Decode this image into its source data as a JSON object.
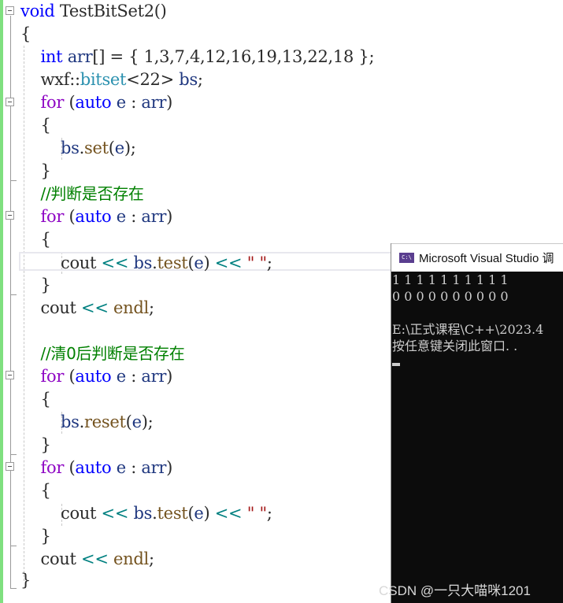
{
  "editor": {
    "lines": [
      {
        "segments": [
          {
            "t": "void",
            "c": "kw"
          },
          {
            "t": " TestBitSet2()",
            "c": "ns"
          }
        ]
      },
      {
        "segments": [
          {
            "t": "{",
            "c": "ns"
          }
        ]
      },
      {
        "segments": [
          {
            "t": "    "
          },
          {
            "t": "int",
            "c": "kw"
          },
          {
            "t": " "
          },
          {
            "t": "arr",
            "c": "var"
          },
          {
            "t": "[] = { 1,3,7,4,12,16,19,13,22,18 };",
            "c": "ns"
          }
        ]
      },
      {
        "segments": [
          {
            "t": "    wxf::",
            "c": "ns"
          },
          {
            "t": "bitset",
            "c": "type"
          },
          {
            "t": "<22> ",
            "c": "ns"
          },
          {
            "t": "bs",
            "c": "var"
          },
          {
            "t": ";",
            "c": "ns"
          }
        ]
      },
      {
        "segments": [
          {
            "t": "    "
          },
          {
            "t": "for",
            "c": "kw2"
          },
          {
            "t": " (",
            "c": "ns"
          },
          {
            "t": "auto",
            "c": "kw"
          },
          {
            "t": " "
          },
          {
            "t": "e",
            "c": "var"
          },
          {
            "t": " : ",
            "c": "ns"
          },
          {
            "t": "arr",
            "c": "var"
          },
          {
            "t": ")",
            "c": "ns"
          }
        ]
      },
      {
        "segments": [
          {
            "t": "    {",
            "c": "ns"
          }
        ]
      },
      {
        "segments": [
          {
            "t": "        "
          },
          {
            "t": "bs",
            "c": "var"
          },
          {
            "t": ".",
            "c": "ns"
          },
          {
            "t": "set",
            "c": "fn"
          },
          {
            "t": "(",
            "c": "ns"
          },
          {
            "t": "e",
            "c": "var"
          },
          {
            "t": ");",
            "c": "ns"
          }
        ]
      },
      {
        "segments": [
          {
            "t": "    }",
            "c": "ns"
          }
        ]
      },
      {
        "segments": [
          {
            "t": "    "
          },
          {
            "t": "//判断是否存在",
            "c": "cmt"
          }
        ]
      },
      {
        "segments": [
          {
            "t": "    "
          },
          {
            "t": "for",
            "c": "kw2"
          },
          {
            "t": " (",
            "c": "ns"
          },
          {
            "t": "auto",
            "c": "kw"
          },
          {
            "t": " "
          },
          {
            "t": "e",
            "c": "var"
          },
          {
            "t": " : ",
            "c": "ns"
          },
          {
            "t": "arr",
            "c": "var"
          },
          {
            "t": ")",
            "c": "ns"
          }
        ]
      },
      {
        "segments": [
          {
            "t": "    {",
            "c": "ns"
          }
        ]
      },
      {
        "segments": [
          {
            "t": "        cout ",
            "c": "ns"
          },
          {
            "t": "<<",
            "c": "op"
          },
          {
            "t": " "
          },
          {
            "t": "bs",
            "c": "var"
          },
          {
            "t": ".",
            "c": "ns"
          },
          {
            "t": "test",
            "c": "fn"
          },
          {
            "t": "(",
            "c": "ns"
          },
          {
            "t": "e",
            "c": "var"
          },
          {
            "t": ") ",
            "c": "ns"
          },
          {
            "t": "<<",
            "c": "op"
          },
          {
            "t": " "
          },
          {
            "t": "\" \"",
            "c": "str"
          },
          {
            "t": ";",
            "c": "ns"
          }
        ]
      },
      {
        "segments": [
          {
            "t": "    }",
            "c": "ns"
          }
        ]
      },
      {
        "segments": [
          {
            "t": "    cout ",
            "c": "ns"
          },
          {
            "t": "<<",
            "c": "op"
          },
          {
            "t": " "
          },
          {
            "t": "endl",
            "c": "fn"
          },
          {
            "t": ";",
            "c": "ns"
          }
        ]
      },
      {
        "segments": []
      },
      {
        "segments": [
          {
            "t": "    "
          },
          {
            "t": "//清0后判断是否存在",
            "c": "cmt"
          }
        ]
      },
      {
        "segments": [
          {
            "t": "    "
          },
          {
            "t": "for",
            "c": "kw2"
          },
          {
            "t": " (",
            "c": "ns"
          },
          {
            "t": "auto",
            "c": "kw"
          },
          {
            "t": " "
          },
          {
            "t": "e",
            "c": "var"
          },
          {
            "t": " : ",
            "c": "ns"
          },
          {
            "t": "arr",
            "c": "var"
          },
          {
            "t": ")",
            "c": "ns"
          }
        ]
      },
      {
        "segments": [
          {
            "t": "    {",
            "c": "ns"
          }
        ]
      },
      {
        "segments": [
          {
            "t": "        "
          },
          {
            "t": "bs",
            "c": "var"
          },
          {
            "t": ".",
            "c": "ns"
          },
          {
            "t": "reset",
            "c": "fn"
          },
          {
            "t": "(",
            "c": "ns"
          },
          {
            "t": "e",
            "c": "var"
          },
          {
            "t": ");",
            "c": "ns"
          }
        ]
      },
      {
        "segments": [
          {
            "t": "    }",
            "c": "ns"
          }
        ]
      },
      {
        "segments": [
          {
            "t": "    "
          },
          {
            "t": "for",
            "c": "kw2"
          },
          {
            "t": " (",
            "c": "ns"
          },
          {
            "t": "auto",
            "c": "kw"
          },
          {
            "t": " "
          },
          {
            "t": "e",
            "c": "var"
          },
          {
            "t": " : ",
            "c": "ns"
          },
          {
            "t": "arr",
            "c": "var"
          },
          {
            "t": ")",
            "c": "ns"
          }
        ]
      },
      {
        "segments": [
          {
            "t": "    {",
            "c": "ns"
          }
        ]
      },
      {
        "segments": [
          {
            "t": "        cout ",
            "c": "ns"
          },
          {
            "t": "<<",
            "c": "op"
          },
          {
            "t": " "
          },
          {
            "t": "bs",
            "c": "var"
          },
          {
            "t": ".",
            "c": "ns"
          },
          {
            "t": "test",
            "c": "fn"
          },
          {
            "t": "(",
            "c": "ns"
          },
          {
            "t": "e",
            "c": "var"
          },
          {
            "t": ") ",
            "c": "ns"
          },
          {
            "t": "<<",
            "c": "op"
          },
          {
            "t": " "
          },
          {
            "t": "\" \"",
            "c": "str"
          },
          {
            "t": ";",
            "c": "ns"
          }
        ]
      },
      {
        "segments": [
          {
            "t": "    }",
            "c": "ns"
          }
        ]
      },
      {
        "segments": [
          {
            "t": "    cout ",
            "c": "ns"
          },
          {
            "t": "<<",
            "c": "op"
          },
          {
            "t": " "
          },
          {
            "t": "endl",
            "c": "fn"
          },
          {
            "t": ";",
            "c": "ns"
          }
        ]
      },
      {
        "segments": [
          {
            "t": "}",
            "c": "ns"
          }
        ]
      }
    ]
  },
  "console": {
    "title": "Microsoft Visual Studio 调",
    "icon": "console-app-icon",
    "icon_text": "C:\\",
    "output_lines": [
      "1 1 1 1 1 1 1 1 1 1",
      "0 0 0 0 0 0 0 0 0 0",
      "",
      "E:\\正式课程\\C++\\2023.4",
      "按任意键关闭此窗口. ."
    ]
  },
  "watermark": "CSDN @一只大喵咪1201"
}
